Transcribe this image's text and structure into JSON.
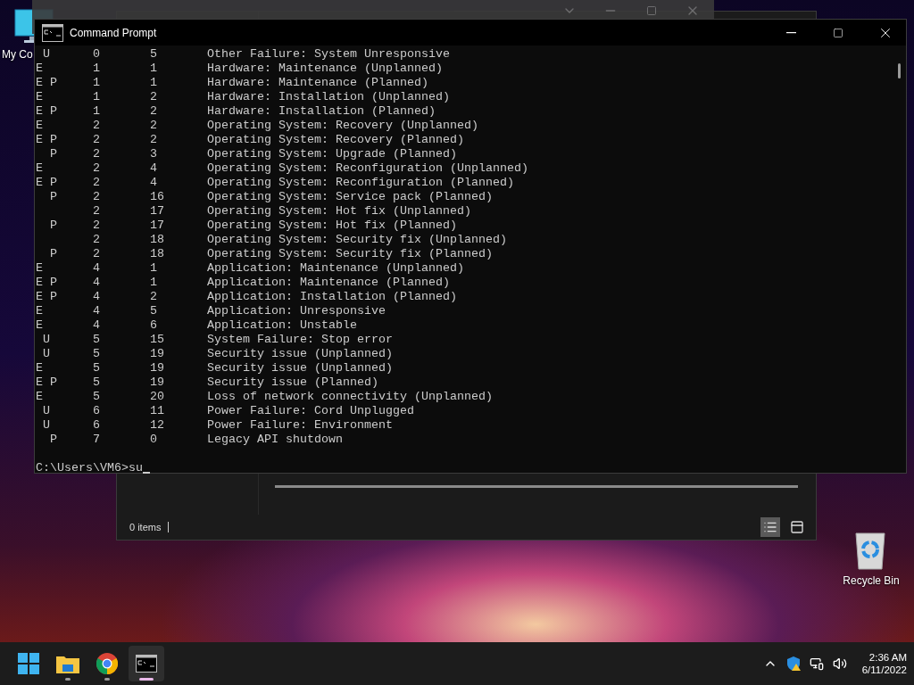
{
  "desktop_icons": [
    {
      "kind": "computer",
      "label": "My Co"
    },
    {
      "kind": "recycle",
      "label": "Recycle Bin"
    }
  ],
  "background_window": {
    "status": "0 items"
  },
  "console": {
    "title": "Command Prompt",
    "lines": [
      " U      0       5       Other Failure: System Unresponsive",
      "E       1       1       Hardware: Maintenance (Unplanned)",
      "E P     1       1       Hardware: Maintenance (Planned)",
      "E       1       2       Hardware: Installation (Unplanned)",
      "E P     1       2       Hardware: Installation (Planned)",
      "E       2       2       Operating System: Recovery (Unplanned)",
      "E P     2       2       Operating System: Recovery (Planned)",
      "  P     2       3       Operating System: Upgrade (Planned)",
      "E       2       4       Operating System: Reconfiguration (Unplanned)",
      "E P     2       4       Operating System: Reconfiguration (Planned)",
      "  P     2       16      Operating System: Service pack (Planned)",
      "        2       17      Operating System: Hot fix (Unplanned)",
      "  P     2       17      Operating System: Hot fix (Planned)",
      "        2       18      Operating System: Security fix (Unplanned)",
      "  P     2       18      Operating System: Security fix (Planned)",
      "E       4       1       Application: Maintenance (Unplanned)",
      "E P     4       1       Application: Maintenance (Planned)",
      "E P     4       2       Application: Installation (Planned)",
      "E       4       5       Application: Unresponsive",
      "E       4       6       Application: Unstable",
      " U      5       15      System Failure: Stop error",
      " U      5       19      Security issue (Unplanned)",
      "E       5       19      Security issue (Unplanned)",
      "E P     5       19      Security issue (Planned)",
      "E       5       20      Loss of network connectivity (Unplanned)",
      " U      6       11      Power Failure: Cord Unplugged",
      " U      6       12      Power Failure: Environment",
      "  P     7       0       Legacy API shutdown"
    ],
    "prompt": "C:\\Users\\VM6>su"
  },
  "taskbar": {
    "apps": [
      {
        "kind": "start",
        "selected": false,
        "running": false
      },
      {
        "kind": "folder",
        "selected": false,
        "running": true
      },
      {
        "kind": "browser",
        "selected": false,
        "running": true
      },
      {
        "kind": "terminal",
        "selected": true,
        "running": true
      }
    ],
    "clock": {
      "time": "2:36 AM",
      "date": "6/11/2022"
    }
  }
}
